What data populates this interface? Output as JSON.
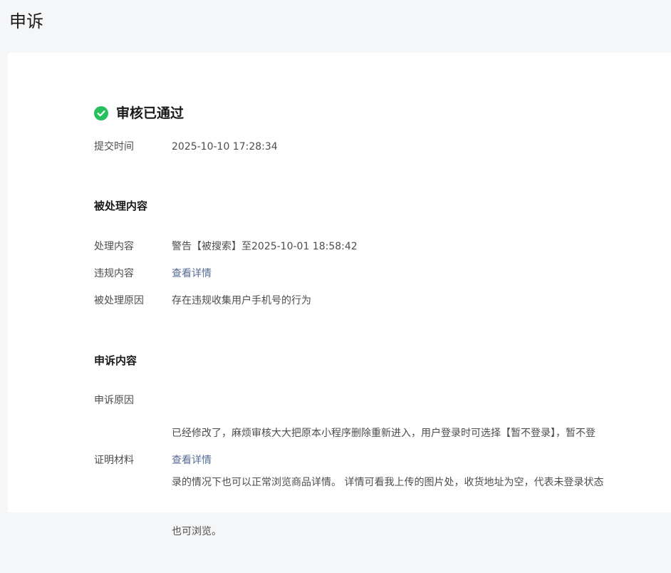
{
  "page": {
    "title": "申诉"
  },
  "status": {
    "text": "审核已通过",
    "icon": "check-circle-icon",
    "color": "#27c05e"
  },
  "submit": {
    "label": "提交时间",
    "value": "2025-10-10 17:28:34"
  },
  "processed": {
    "section_title": "被处理内容",
    "content_label": "处理内容",
    "content_value": "警告【被搜索】至2025-10-01 18:58:42",
    "violation_label": "违规内容",
    "violation_link": "查看详情",
    "reason_label": "被处理原因",
    "reason_value": "存在违规收集用户手机号的行为"
  },
  "appeal": {
    "section_title": "申诉内容",
    "reason_label": "申诉原因",
    "reason_lines": [
      "已经修改了，麻烦审核大大把原本小程序删除重新进入，用户登录时可选择【暂不登录】，暂不登",
      "录的情况下也可以正常浏览商品详情。 详情可看我上传的图片处，收货地址为空，代表未登录状态",
      "也可浏览。"
    ],
    "proof_label": "证明材料",
    "proof_link": "查看详情"
  }
}
